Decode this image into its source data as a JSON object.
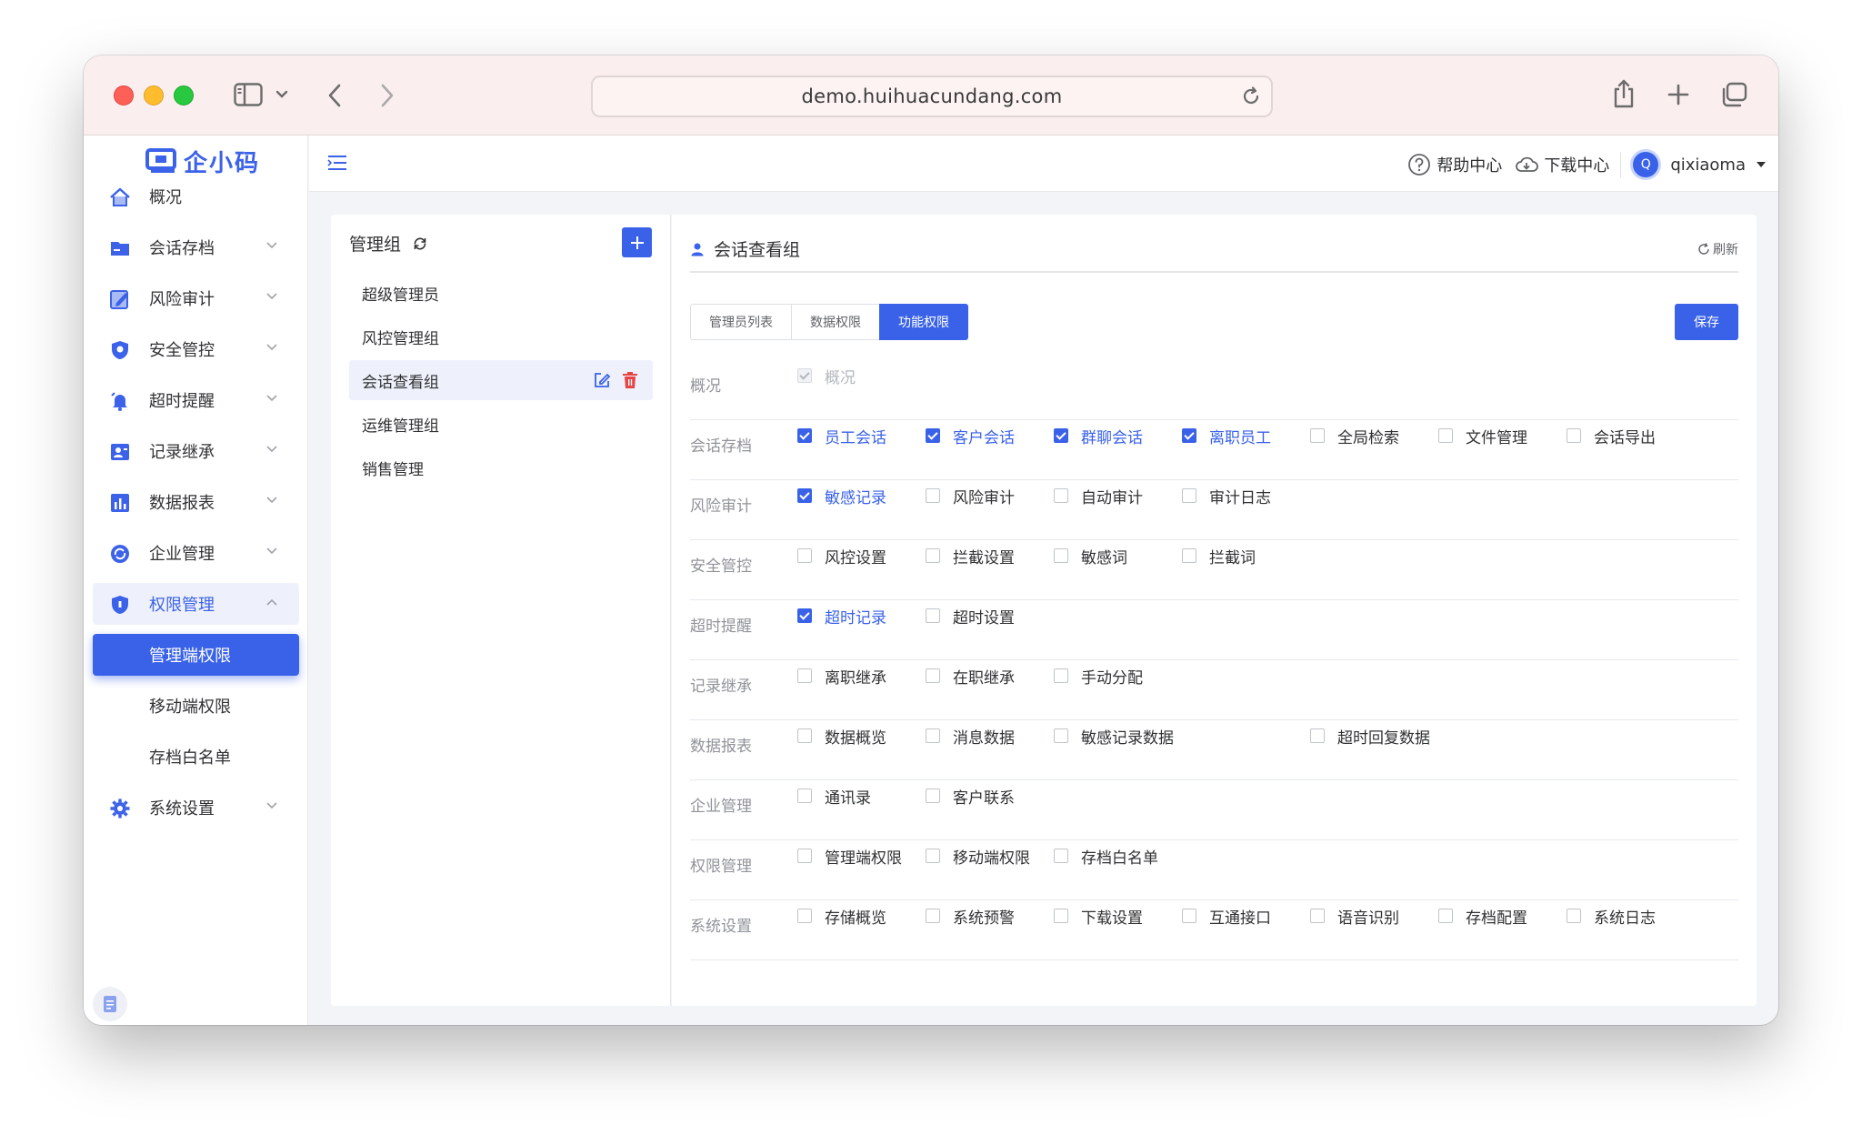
{
  "browser": {
    "url": "demo.huihuacundang.com"
  },
  "logo": {
    "text": "企小码"
  },
  "sidebar": {
    "items": [
      {
        "label": "概况",
        "icon": "home-icon"
      },
      {
        "label": "会话存档",
        "icon": "folder-icon"
      },
      {
        "label": "风险审计",
        "icon": "edit-icon"
      },
      {
        "label": "安全管控",
        "icon": "shield-icon"
      },
      {
        "label": "超时提醒",
        "icon": "bell-icon"
      },
      {
        "label": "记录继承",
        "icon": "records-icon"
      },
      {
        "label": "数据报表",
        "icon": "chart-icon"
      },
      {
        "label": "企业管理",
        "icon": "enterprise-icon"
      },
      {
        "label": "权限管理",
        "icon": "lock-shield-icon"
      },
      {
        "label": "管理端权限"
      },
      {
        "label": "移动端权限"
      },
      {
        "label": "存档白名单"
      },
      {
        "label": "系统设置",
        "icon": "gear-icon"
      }
    ]
  },
  "topbar": {
    "help": "帮助中心",
    "download": "下载中心",
    "user": "qixiaoma",
    "avatar_letter": "Q"
  },
  "groups": {
    "title": "管理组",
    "items": [
      "超级管理员",
      "风控管理组",
      "会话查看组",
      "运维管理组",
      "销售管理"
    ]
  },
  "detail": {
    "title": "会话查看组",
    "refresh": "刷新",
    "tabs": [
      "管理员列表",
      "数据权限",
      "功能权限"
    ],
    "save": "保存",
    "rows": [
      {
        "label": "概况",
        "options": [
          {
            "label": "概况",
            "checked": true,
            "disabled": true
          }
        ]
      },
      {
        "label": "会话存档",
        "options": [
          {
            "label": "员工会话",
            "checked": true
          },
          {
            "label": "客户会话",
            "checked": true
          },
          {
            "label": "群聊会话",
            "checked": true
          },
          {
            "label": "离职员工",
            "checked": true
          },
          {
            "label": "全局检索",
            "checked": false
          },
          {
            "label": "文件管理",
            "checked": false
          },
          {
            "label": "会话导出",
            "checked": false
          }
        ]
      },
      {
        "label": "风险审计",
        "options": [
          {
            "label": "敏感记录",
            "checked": true
          },
          {
            "label": "风险审计",
            "checked": false
          },
          {
            "label": "自动审计",
            "checked": false
          },
          {
            "label": "审计日志",
            "checked": false
          }
        ]
      },
      {
        "label": "安全管控",
        "options": [
          {
            "label": "风控设置",
            "checked": false
          },
          {
            "label": "拦截设置",
            "checked": false
          },
          {
            "label": "敏感词",
            "checked": false
          },
          {
            "label": "拦截词",
            "checked": false
          }
        ]
      },
      {
        "label": "超时提醒",
        "options": [
          {
            "label": "超时记录",
            "checked": true
          },
          {
            "label": "超时设置",
            "checked": false
          }
        ]
      },
      {
        "label": "记录继承",
        "options": [
          {
            "label": "离职继承",
            "checked": false
          },
          {
            "label": "在职继承",
            "checked": false
          },
          {
            "label": "手动分配",
            "checked": false
          }
        ]
      },
      {
        "label": "数据报表",
        "options": [
          {
            "label": "数据概览",
            "checked": false
          },
          {
            "label": "消息数据",
            "checked": false
          },
          {
            "label": "敏感记录数据",
            "checked": false
          },
          {
            "label": "超时回复数据",
            "checked": false
          }
        ]
      },
      {
        "label": "企业管理",
        "options": [
          {
            "label": "通讯录",
            "checked": false
          },
          {
            "label": "客户联系",
            "checked": false
          }
        ]
      },
      {
        "label": "权限管理",
        "options": [
          {
            "label": "管理端权限",
            "checked": false
          },
          {
            "label": "移动端权限",
            "checked": false
          },
          {
            "label": "存档白名单",
            "checked": false
          }
        ]
      },
      {
        "label": "系统设置",
        "options": [
          {
            "label": "存储概览",
            "checked": false
          },
          {
            "label": "系统预警",
            "checked": false
          },
          {
            "label": "下载设置",
            "checked": false
          },
          {
            "label": "互通接口",
            "checked": false
          },
          {
            "label": "语音识别",
            "checked": false
          },
          {
            "label": "存档配置",
            "checked": false
          },
          {
            "label": "系统日志",
            "checked": false
          }
        ]
      }
    ]
  },
  "colors": {
    "accent": "#3a62e8",
    "titlebar": "#fbeeee",
    "danger": "#e64545"
  }
}
